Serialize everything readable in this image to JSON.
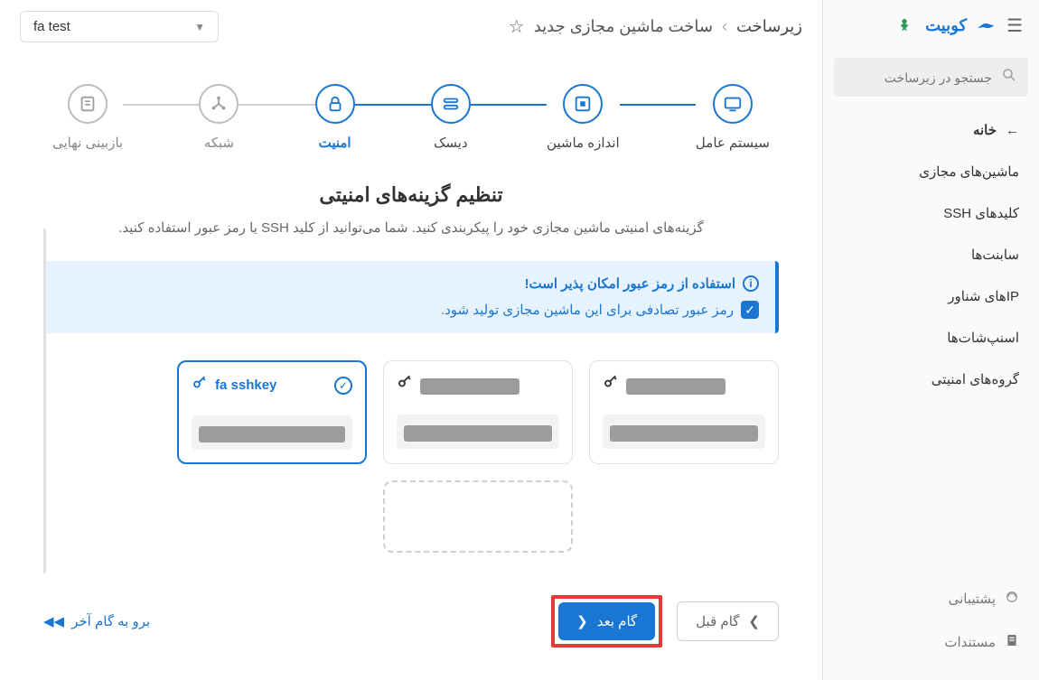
{
  "brand": {
    "name": "کوبیت"
  },
  "search": {
    "placeholder": "جستجو در زیرساخت"
  },
  "nav": {
    "home": "خانه",
    "vms": "ماشین‌های مجازی",
    "ssh": "کلیدهای SSH",
    "subnets": "سابنت‌ها",
    "floatips": "IPهای شناور",
    "snapshots": "اسنپ‌شات‌ها",
    "secgroups": "گروه‌های امنیتی",
    "support": "پشتیبانی",
    "docs": "مستندات"
  },
  "breadcrumb": {
    "root": "زیرساخت",
    "page": "ساخت ماشین مجازی جدید"
  },
  "project_select": {
    "value": "fa test"
  },
  "steps": {
    "os": "سیستم عامل",
    "size": "اندازه ماشین",
    "disk": "دیسک",
    "security": "امنیت",
    "network": "شبکه",
    "review": "بازبینی نهایی"
  },
  "section": {
    "title": "تنظیم گزینه‌های امنیتی",
    "desc": "گزینه‌های امنیتی ماشین مجازی خود را پیکربندی کنید. شما می‌توانید از کلید SSH یا رمز عبور استفاده کنید."
  },
  "infobox": {
    "title": "استفاده از رمز عبور امکان پذیر است!",
    "check": "رمز عبور تصادفی برای این ماشین مجازی تولید شود."
  },
  "keys": {
    "selected_name": "fa sshkey"
  },
  "footer": {
    "prev": "گام قبل",
    "next": "گام بعد",
    "last": "برو به گام آخر"
  }
}
